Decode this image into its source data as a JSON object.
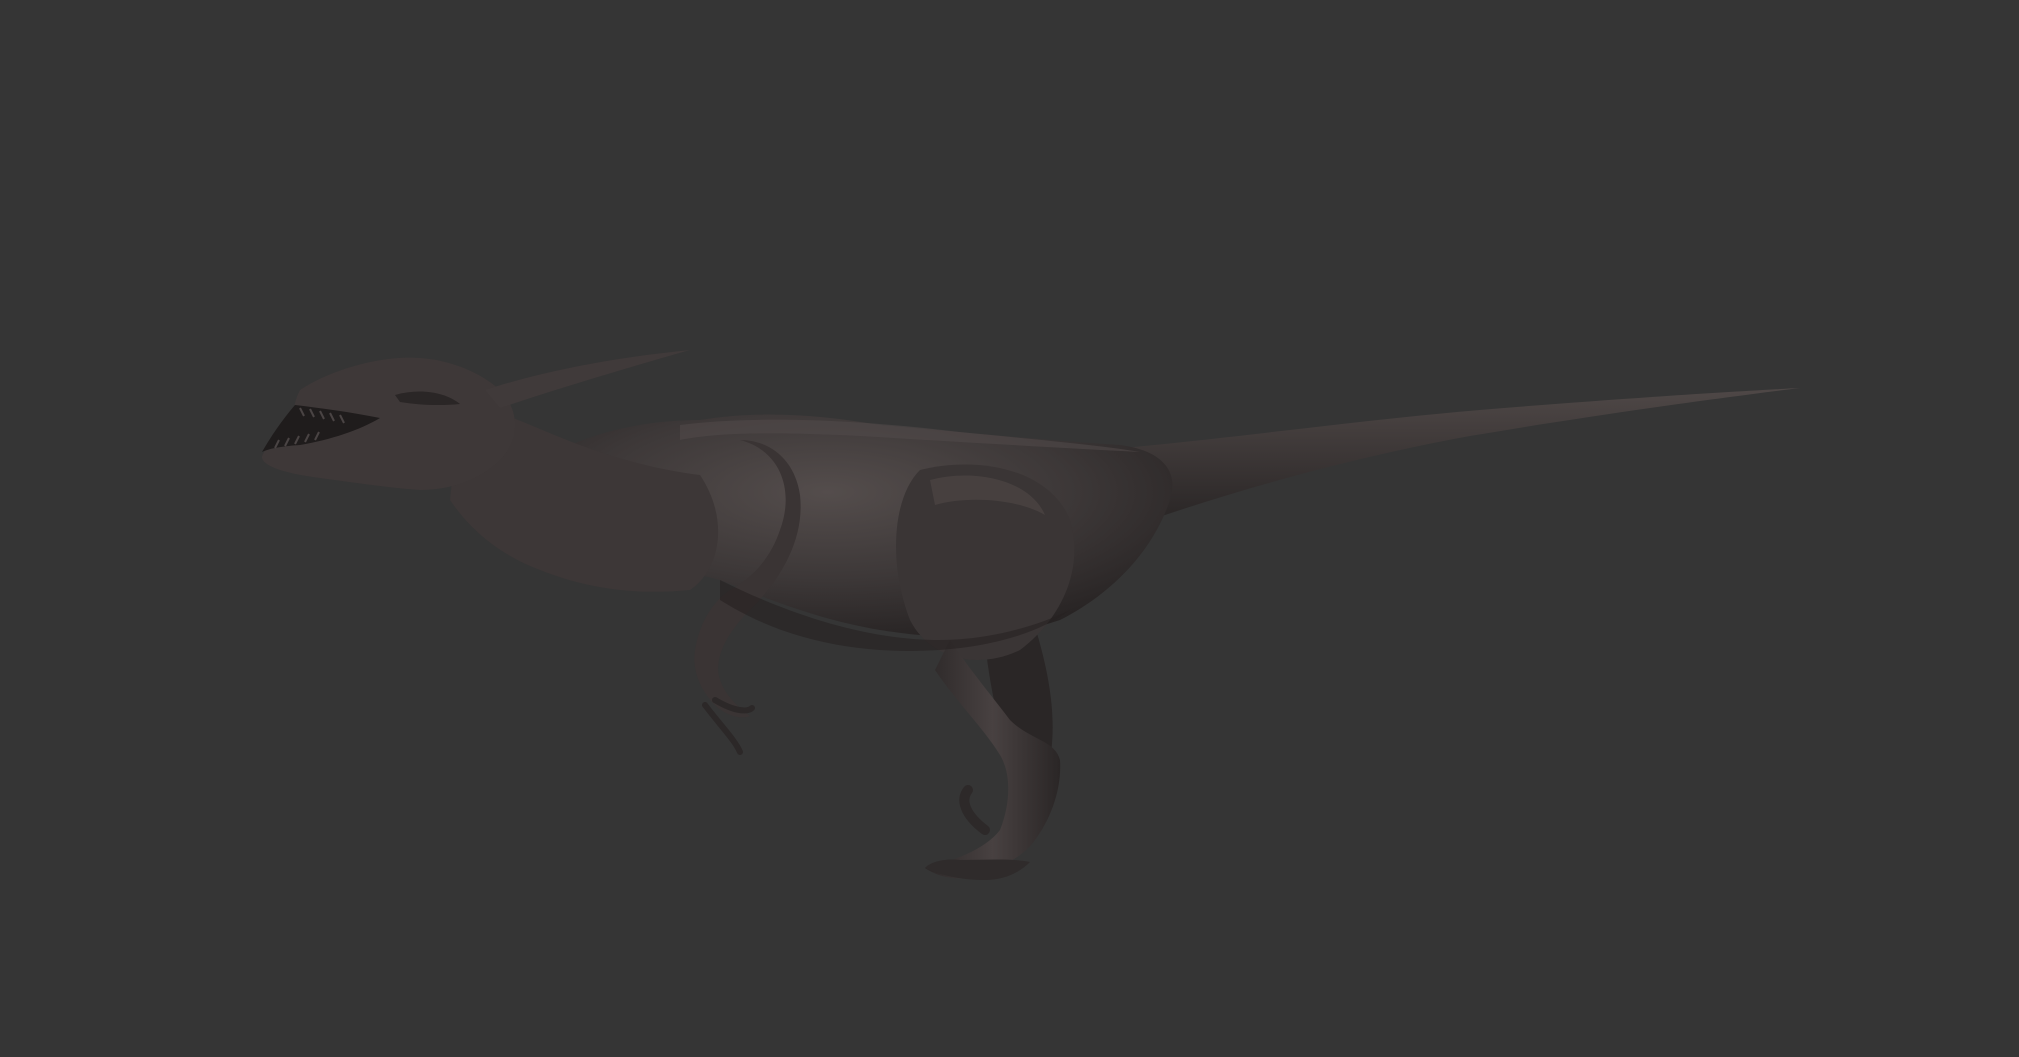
{
  "scene": {
    "background_color": "#353535",
    "subject": "dinosaur-sculpt",
    "model_colors": {
      "base": "#3d3838",
      "shadow": "#242121",
      "highlight": "#544d4c",
      "rim": "#5e5655"
    }
  }
}
